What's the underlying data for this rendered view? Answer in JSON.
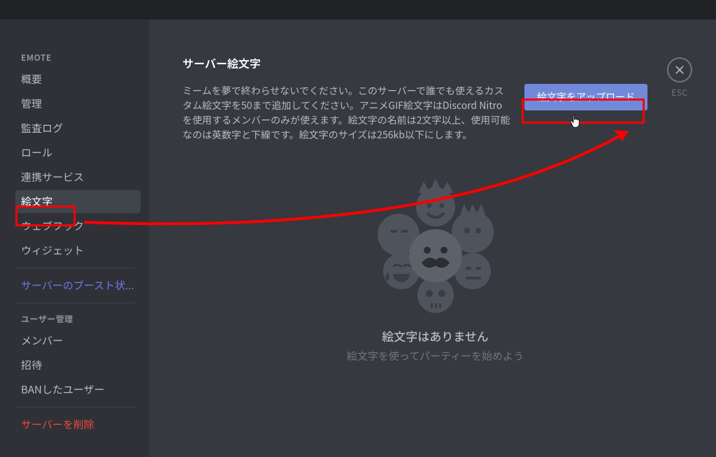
{
  "sidebar": {
    "section1_title": "EMOTE",
    "items1": [
      {
        "label": "概要"
      },
      {
        "label": "管理"
      },
      {
        "label": "監査ログ"
      },
      {
        "label": "ロール"
      },
      {
        "label": "連携サービス"
      },
      {
        "label": "絵文字"
      },
      {
        "label": "ウェブフック"
      },
      {
        "label": "ウィジェット"
      }
    ],
    "boost_label": "サーバーのブースト状...",
    "section2_title": "ユーザー管理",
    "items2": [
      {
        "label": "メンバー"
      },
      {
        "label": "招待"
      },
      {
        "label": "BANしたユーザー"
      }
    ],
    "delete_label": "サーバーを削除"
  },
  "main": {
    "title": "サーバー絵文字",
    "description": "ミームを夢で終わらせないでください。このサーバーで誰でも使えるカスタム絵文字を50まで追加してください。アニメGIF絵文字はDiscord Nitroを使用するメンバーのみが使えます。絵文字の名前は2文字以上、使用可能なのは英数字と下線です。絵文字のサイズは256kb以下にします。",
    "upload_label": "絵文字をアップロード",
    "empty_title": "絵文字はありません",
    "empty_sub": "絵文字を使ってパーティーを始めよう"
  },
  "close": {
    "esc_label": "ESC"
  }
}
